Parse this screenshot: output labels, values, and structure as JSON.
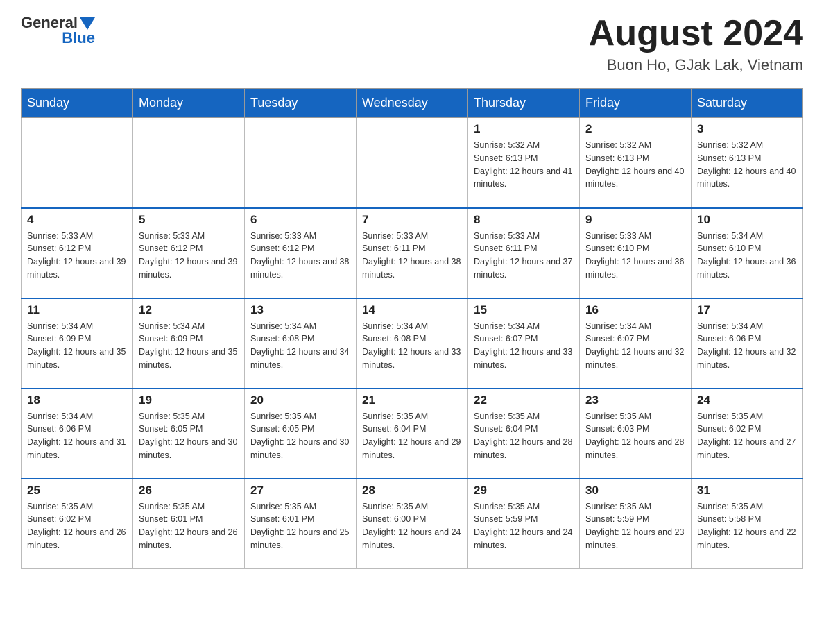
{
  "header": {
    "logo_general": "General",
    "logo_blue": "Blue",
    "month_title": "August 2024",
    "location": "Buon Ho, GJak Lak, Vietnam"
  },
  "days_of_week": [
    "Sunday",
    "Monday",
    "Tuesday",
    "Wednesday",
    "Thursday",
    "Friday",
    "Saturday"
  ],
  "weeks": [
    [
      {
        "day": "",
        "sunrise": "",
        "sunset": "",
        "daylight": ""
      },
      {
        "day": "",
        "sunrise": "",
        "sunset": "",
        "daylight": ""
      },
      {
        "day": "",
        "sunrise": "",
        "sunset": "",
        "daylight": ""
      },
      {
        "day": "",
        "sunrise": "",
        "sunset": "",
        "daylight": ""
      },
      {
        "day": "1",
        "sunrise": "Sunrise: 5:32 AM",
        "sunset": "Sunset: 6:13 PM",
        "daylight": "Daylight: 12 hours and 41 minutes."
      },
      {
        "day": "2",
        "sunrise": "Sunrise: 5:32 AM",
        "sunset": "Sunset: 6:13 PM",
        "daylight": "Daylight: 12 hours and 40 minutes."
      },
      {
        "day": "3",
        "sunrise": "Sunrise: 5:32 AM",
        "sunset": "Sunset: 6:13 PM",
        "daylight": "Daylight: 12 hours and 40 minutes."
      }
    ],
    [
      {
        "day": "4",
        "sunrise": "Sunrise: 5:33 AM",
        "sunset": "Sunset: 6:12 PM",
        "daylight": "Daylight: 12 hours and 39 minutes."
      },
      {
        "day": "5",
        "sunrise": "Sunrise: 5:33 AM",
        "sunset": "Sunset: 6:12 PM",
        "daylight": "Daylight: 12 hours and 39 minutes."
      },
      {
        "day": "6",
        "sunrise": "Sunrise: 5:33 AM",
        "sunset": "Sunset: 6:12 PM",
        "daylight": "Daylight: 12 hours and 38 minutes."
      },
      {
        "day": "7",
        "sunrise": "Sunrise: 5:33 AM",
        "sunset": "Sunset: 6:11 PM",
        "daylight": "Daylight: 12 hours and 38 minutes."
      },
      {
        "day": "8",
        "sunrise": "Sunrise: 5:33 AM",
        "sunset": "Sunset: 6:11 PM",
        "daylight": "Daylight: 12 hours and 37 minutes."
      },
      {
        "day": "9",
        "sunrise": "Sunrise: 5:33 AM",
        "sunset": "Sunset: 6:10 PM",
        "daylight": "Daylight: 12 hours and 36 minutes."
      },
      {
        "day": "10",
        "sunrise": "Sunrise: 5:34 AM",
        "sunset": "Sunset: 6:10 PM",
        "daylight": "Daylight: 12 hours and 36 minutes."
      }
    ],
    [
      {
        "day": "11",
        "sunrise": "Sunrise: 5:34 AM",
        "sunset": "Sunset: 6:09 PM",
        "daylight": "Daylight: 12 hours and 35 minutes."
      },
      {
        "day": "12",
        "sunrise": "Sunrise: 5:34 AM",
        "sunset": "Sunset: 6:09 PM",
        "daylight": "Daylight: 12 hours and 35 minutes."
      },
      {
        "day": "13",
        "sunrise": "Sunrise: 5:34 AM",
        "sunset": "Sunset: 6:08 PM",
        "daylight": "Daylight: 12 hours and 34 minutes."
      },
      {
        "day": "14",
        "sunrise": "Sunrise: 5:34 AM",
        "sunset": "Sunset: 6:08 PM",
        "daylight": "Daylight: 12 hours and 33 minutes."
      },
      {
        "day": "15",
        "sunrise": "Sunrise: 5:34 AM",
        "sunset": "Sunset: 6:07 PM",
        "daylight": "Daylight: 12 hours and 33 minutes."
      },
      {
        "day": "16",
        "sunrise": "Sunrise: 5:34 AM",
        "sunset": "Sunset: 6:07 PM",
        "daylight": "Daylight: 12 hours and 32 minutes."
      },
      {
        "day": "17",
        "sunrise": "Sunrise: 5:34 AM",
        "sunset": "Sunset: 6:06 PM",
        "daylight": "Daylight: 12 hours and 32 minutes."
      }
    ],
    [
      {
        "day": "18",
        "sunrise": "Sunrise: 5:34 AM",
        "sunset": "Sunset: 6:06 PM",
        "daylight": "Daylight: 12 hours and 31 minutes."
      },
      {
        "day": "19",
        "sunrise": "Sunrise: 5:35 AM",
        "sunset": "Sunset: 6:05 PM",
        "daylight": "Daylight: 12 hours and 30 minutes."
      },
      {
        "day": "20",
        "sunrise": "Sunrise: 5:35 AM",
        "sunset": "Sunset: 6:05 PM",
        "daylight": "Daylight: 12 hours and 30 minutes."
      },
      {
        "day": "21",
        "sunrise": "Sunrise: 5:35 AM",
        "sunset": "Sunset: 6:04 PM",
        "daylight": "Daylight: 12 hours and 29 minutes."
      },
      {
        "day": "22",
        "sunrise": "Sunrise: 5:35 AM",
        "sunset": "Sunset: 6:04 PM",
        "daylight": "Daylight: 12 hours and 28 minutes."
      },
      {
        "day": "23",
        "sunrise": "Sunrise: 5:35 AM",
        "sunset": "Sunset: 6:03 PM",
        "daylight": "Daylight: 12 hours and 28 minutes."
      },
      {
        "day": "24",
        "sunrise": "Sunrise: 5:35 AM",
        "sunset": "Sunset: 6:02 PM",
        "daylight": "Daylight: 12 hours and 27 minutes."
      }
    ],
    [
      {
        "day": "25",
        "sunrise": "Sunrise: 5:35 AM",
        "sunset": "Sunset: 6:02 PM",
        "daylight": "Daylight: 12 hours and 26 minutes."
      },
      {
        "day": "26",
        "sunrise": "Sunrise: 5:35 AM",
        "sunset": "Sunset: 6:01 PM",
        "daylight": "Daylight: 12 hours and 26 minutes."
      },
      {
        "day": "27",
        "sunrise": "Sunrise: 5:35 AM",
        "sunset": "Sunset: 6:01 PM",
        "daylight": "Daylight: 12 hours and 25 minutes."
      },
      {
        "day": "28",
        "sunrise": "Sunrise: 5:35 AM",
        "sunset": "Sunset: 6:00 PM",
        "daylight": "Daylight: 12 hours and 24 minutes."
      },
      {
        "day": "29",
        "sunrise": "Sunrise: 5:35 AM",
        "sunset": "Sunset: 5:59 PM",
        "daylight": "Daylight: 12 hours and 24 minutes."
      },
      {
        "day": "30",
        "sunrise": "Sunrise: 5:35 AM",
        "sunset": "Sunset: 5:59 PM",
        "daylight": "Daylight: 12 hours and 23 minutes."
      },
      {
        "day": "31",
        "sunrise": "Sunrise: 5:35 AM",
        "sunset": "Sunset: 5:58 PM",
        "daylight": "Daylight: 12 hours and 22 minutes."
      }
    ]
  ]
}
